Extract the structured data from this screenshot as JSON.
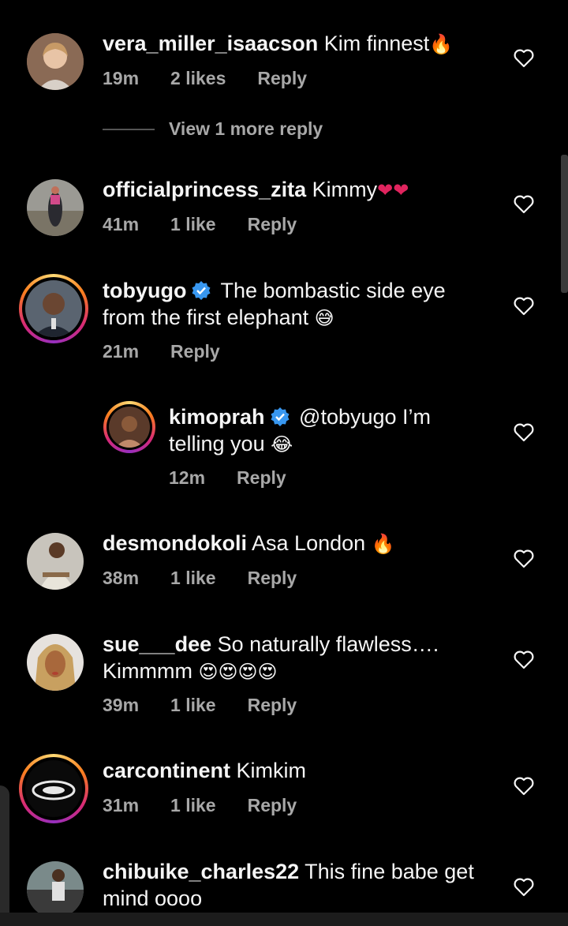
{
  "view_more": "View 1 more reply",
  "comments": [
    {
      "username": "vera_miller_isaacson",
      "text": "Kim finnest",
      "emoji": "🔥",
      "time": "19m",
      "likes": "2 likes",
      "reply": "Reply"
    },
    {
      "username": "officialprincess_zita",
      "text": "Kimmy",
      "emoji": "❤❤",
      "time": "41m",
      "likes": "1 like",
      "reply": "Reply"
    },
    {
      "username": "tobyugo",
      "text": "The bombastic side eye",
      "text2": "from the first elephant",
      "emoji": "😅",
      "time": "21m",
      "reply": "Reply"
    },
    {
      "username": "kimoprah",
      "text": "@tobyugo I’m",
      "text2": "telling you",
      "emoji": "😂",
      "time": "12m",
      "reply": "Reply"
    },
    {
      "username": "desmondokoli",
      "text": "Asa London",
      "emoji": "🔥",
      "time": "38m",
      "likes": "1 like",
      "reply": "Reply"
    },
    {
      "username": "sue___dee",
      "text": "So naturally flawless….",
      "text2": "Kimmmm",
      "emoji": "😍😍😍😍",
      "time": "39m",
      "likes": "1 like",
      "reply": "Reply"
    },
    {
      "username": "carcontinent",
      "text": "Kimkim",
      "time": "31m",
      "likes": "1 like",
      "reply": "Reply"
    },
    {
      "username": "chibuike_charles22",
      "text": "This fine babe get",
      "text2": "mind oooo"
    }
  ],
  "colors": {
    "background": "#000000",
    "meta": "#a8a8a8",
    "verified": "#3897f0",
    "heart_red": "#e0245e"
  },
  "icons": [
    "heart-outline-icon",
    "verified-badge-icon"
  ]
}
